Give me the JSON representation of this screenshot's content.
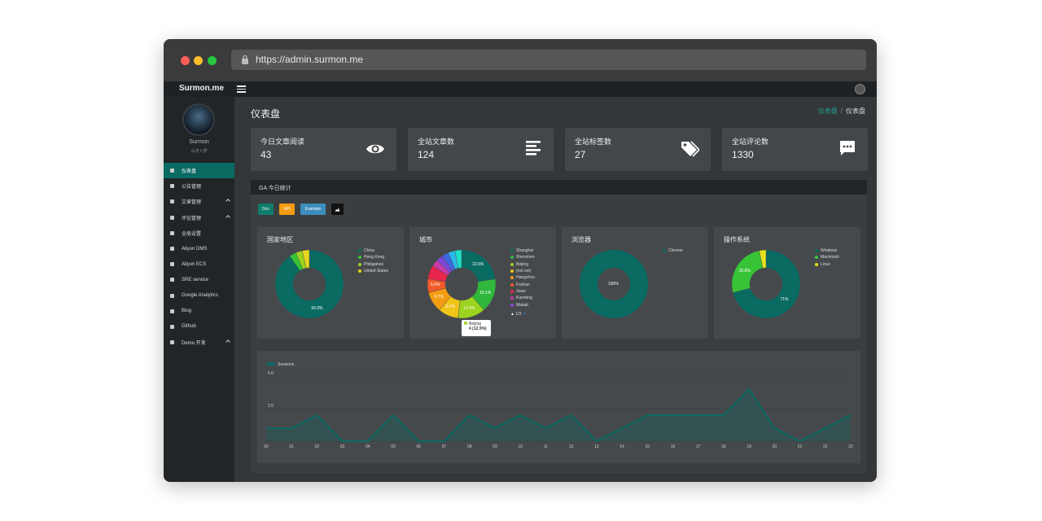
{
  "browser": {
    "url": "https://admin.surmon.me"
  },
  "topbar": {
    "brand": "Surmon.me"
  },
  "sidebar": {
    "user": {
      "name": "Surmon",
      "motto": "山河入梦"
    },
    "items": [
      {
        "label": "仪表盘",
        "icon": "home-icon",
        "active": true
      },
      {
        "label": "公告管理",
        "icon": "sun-icon"
      },
      {
        "label": "文章管理",
        "icon": "book-icon",
        "expandable": true
      },
      {
        "label": "评论管理",
        "icon": "comment-icon",
        "expandable": true
      },
      {
        "label": "全局设置",
        "icon": "gear-icon"
      },
      {
        "label": "Aliyun DMS",
        "icon": "flask-icon"
      },
      {
        "label": "Aliyun ECS",
        "icon": "cloud-icon"
      },
      {
        "label": "SRE service",
        "icon": "fan-icon"
      },
      {
        "label": "Google Analytics",
        "icon": "google-icon"
      },
      {
        "label": "Blog",
        "icon": "user-icon"
      },
      {
        "label": "Github",
        "icon": "github-icon"
      },
      {
        "label": "Demo 开发",
        "icon": "gear-icon",
        "expandable": true
      }
    ]
  },
  "page": {
    "title": "仪表盘"
  },
  "breadcrumb": {
    "home": "仪表盘",
    "separator": "/",
    "current": "仪表盘"
  },
  "stats": [
    {
      "label": "今日文章阅读",
      "value": "43",
      "icon": "eye-icon"
    },
    {
      "label": "全站文章数",
      "value": "124",
      "icon": "list-icon"
    },
    {
      "label": "全站标签数",
      "value": "27",
      "icon": "tags-icon"
    },
    {
      "label": "全站评论数",
      "value": "1330",
      "icon": "comment-icon"
    }
  ],
  "ga": {
    "title": "GA 今日统计",
    "buttons": {
      "doc": "Doc",
      "api": "API",
      "example": "Example"
    }
  },
  "chart_data": [
    {
      "type": "pie",
      "title": "国家地区",
      "categories": [
        "China",
        "Hong Kong",
        "Philippines",
        "United States"
      ],
      "values": [
        90.3,
        3.2,
        3.2,
        3.3
      ],
      "colors": [
        "#0a6b63",
        "#36c436",
        "#9cd31e",
        "#e6d51c"
      ],
      "labels": [
        "90.3%"
      ]
    },
    {
      "type": "pie",
      "title": "城市",
      "categories": [
        "Shanghai",
        "Shenzhen",
        "Beijing",
        "(not set)",
        "Hangzhou",
        "Foshan",
        "Jinan",
        "Kunming",
        "Makati"
      ],
      "values": [
        22.6,
        16.1,
        12.9,
        9.7,
        9.7,
        6.5,
        6.5,
        3.2,
        3.2,
        3.2,
        3.2,
        3.2
      ],
      "colors": [
        "#0a6b63",
        "#2fb83c",
        "#9cd31e",
        "#f0c419",
        "#f39c12",
        "#ef5a28",
        "#e8254b",
        "#c83aa6",
        "#7d47d6",
        "#3c67e0",
        "#2ab8e8",
        "#1ee0c8"
      ],
      "labels": [
        "22.6%",
        "16.1%",
        "12.9%",
        "9.7%",
        "9.7%",
        "6.5%"
      ],
      "pager": "1/3",
      "tooltip": {
        "label": "Beijing",
        "value": "4 (12.9%)"
      }
    },
    {
      "type": "pie",
      "title": "浏览器",
      "categories": [
        "Chrome"
      ],
      "values": [
        100
      ],
      "colors": [
        "#0a6b63"
      ],
      "labels": [
        "100%"
      ]
    },
    {
      "type": "pie",
      "title": "操作系统",
      "categories": [
        "Windows",
        "Macintosh",
        "Linux"
      ],
      "values": [
        71,
        25.8,
        3.2
      ],
      "colors": [
        "#0a6b63",
        "#36c436",
        "#e6e21c"
      ],
      "labels": [
        "71%",
        "25.8%"
      ]
    },
    {
      "type": "area",
      "series": [
        {
          "name": "Sessions",
          "values": [
            1,
            1,
            2,
            0,
            0,
            2,
            0,
            0,
            2,
            1,
            2,
            1,
            2,
            0,
            1,
            2,
            2,
            2,
            2,
            4,
            1,
            0,
            1,
            2
          ]
        }
      ],
      "categories": [
        "00",
        "01",
        "02",
        "03",
        "04",
        "05",
        "06",
        "07",
        "08",
        "09",
        "10",
        "11",
        "12",
        "13",
        "14",
        "15",
        "16",
        "17",
        "18",
        "19",
        "20",
        "21",
        "22",
        "23"
      ],
      "yticks": [
        "5.0",
        "2.5"
      ],
      "ylim": [
        0,
        5
      ],
      "grid": true,
      "legend": "top-left",
      "color": "#0a6b63"
    }
  ]
}
